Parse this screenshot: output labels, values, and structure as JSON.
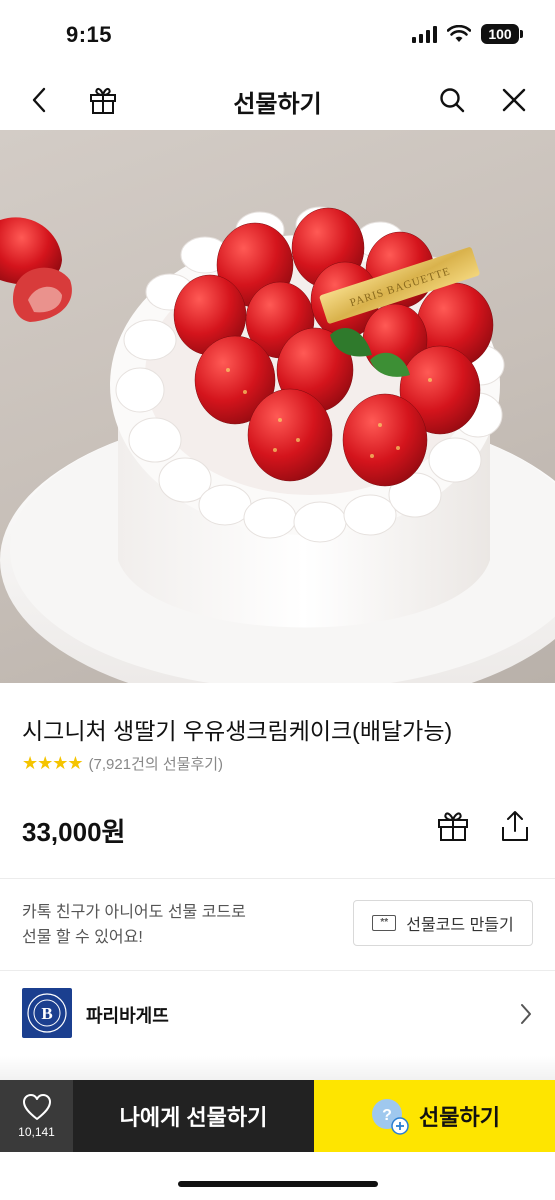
{
  "status_bar": {
    "time": "9:15",
    "battery": "100"
  },
  "nav": {
    "title": "선물하기"
  },
  "product": {
    "title": "시그니처 생딸기 우유생크림케이크(배달가능)",
    "stars": "★★★★",
    "review_count": "(7,921건의 선물후기)",
    "price": "33,000원"
  },
  "hero_image": {
    "topper_text": "PARIS BAGUETTE"
  },
  "gift_code": {
    "line1": "카톡 친구가 아니어도 선물 코드로",
    "line2": "선물 할 수 있어요!",
    "button_label": "선물코드 만들기",
    "button_icon_text": "**"
  },
  "brand": {
    "name": "파리바게뜨",
    "logo_letter": "B"
  },
  "bottom_bar": {
    "wish_count": "10,141",
    "self_gift_label": "나에게 선물하기",
    "gift_label": "선물하기"
  },
  "colors": {
    "accent": "#fee500",
    "dark_button": "#222222",
    "brand_blue": "#1b3f8f",
    "star": "#f5c400"
  }
}
